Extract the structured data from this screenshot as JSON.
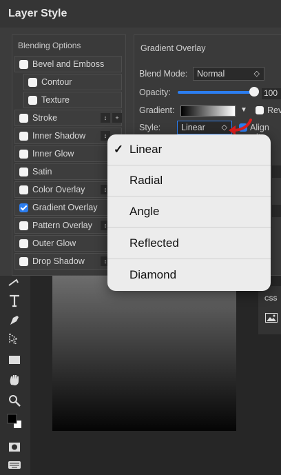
{
  "dialog": {
    "title": "Layer Style"
  },
  "left_panel": {
    "header": "Blending Options",
    "options": [
      {
        "label": "Bevel and Emboss",
        "checked": false
      },
      {
        "label": "Contour",
        "checked": false
      },
      {
        "label": "Texture",
        "checked": false
      },
      {
        "label": "Stroke",
        "checked": false
      },
      {
        "label": "Inner Shadow",
        "checked": false
      },
      {
        "label": "Inner Glow",
        "checked": false
      },
      {
        "label": "Satin",
        "checked": false
      },
      {
        "label": "Color Overlay",
        "checked": false
      },
      {
        "label": "Gradient Overlay",
        "checked": true
      },
      {
        "label": "Pattern Overlay",
        "checked": false
      },
      {
        "label": "Outer Glow",
        "checked": false
      },
      {
        "label": "Drop Shadow",
        "checked": false
      }
    ]
  },
  "gradient_overlay": {
    "header": "Gradient Overlay",
    "blend_mode_label": "Blend Mode:",
    "blend_mode_value": "Normal",
    "opacity_label": "Opacity:",
    "opacity_value": "100",
    "gradient_label": "Gradient:",
    "reverse_label": "Rev",
    "style_label": "Style:",
    "style_value": "Linear",
    "align_label": "Align wit"
  },
  "style_dropdown": {
    "options": [
      "Linear",
      "Radial",
      "Angle",
      "Reflected",
      "Diamond"
    ],
    "selected": "Linear",
    "check_mark": "✓"
  },
  "right_panel": {
    "css_label": "CSS"
  },
  "colors": {
    "accent": "#2c7ef0",
    "arrow": "#e01e1e",
    "dropdown_bg": "#ececec"
  }
}
